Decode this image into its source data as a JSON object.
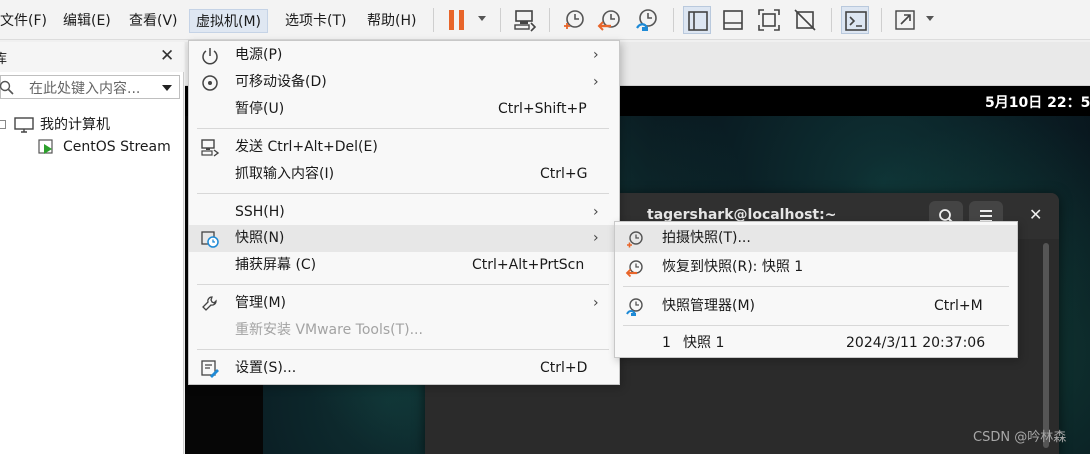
{
  "menubar": {
    "items": [
      {
        "label": "文件(F)"
      },
      {
        "label": "编辑(E)"
      },
      {
        "label": "查看(V)"
      },
      {
        "label": "虚拟机(M)"
      },
      {
        "label": "选项卡(T)"
      },
      {
        "label": "帮助(H)"
      }
    ]
  },
  "toolbar": {
    "icons": [
      "pause-icon",
      "send-ctrl-alt-del-icon",
      "snapshot-take-icon",
      "snapshot-revert-icon",
      "snapshot-manager-icon",
      "show-library-icon",
      "thumbnail-bar-icon",
      "fit-guest-icon",
      "unity-disabled-icon",
      "console-view-icon",
      "full-screen-icon"
    ],
    "accent": "#e8652a"
  },
  "library": {
    "header_fragment": "库",
    "search_placeholder": "在此处键入内容...",
    "tree": [
      {
        "label": "我的计算机"
      },
      {
        "label": "CentOS Stream"
      }
    ]
  },
  "guest": {
    "clock": "5月10日 22：5",
    "terminal_title": "tagershark@localhost:~"
  },
  "vm_menu": {
    "items": [
      {
        "label": "电源(P)",
        "shortcut": "",
        "submenu": true
      },
      {
        "label": "可移动设备(D)",
        "shortcut": "",
        "submenu": true
      },
      {
        "label": "暂停(U)",
        "shortcut": "Ctrl+Shift+P"
      },
      {
        "label": "发送 Ctrl+Alt+Del(E)",
        "shortcut": ""
      },
      {
        "label": "抓取输入内容(I)",
        "shortcut": "Ctrl+G"
      },
      {
        "label": "SSH(H)",
        "shortcut": "",
        "submenu": true
      },
      {
        "label": "快照(N)",
        "shortcut": "",
        "submenu": true
      },
      {
        "label": "捕获屏幕 (C)",
        "shortcut": "Ctrl+Alt+PrtScn"
      },
      {
        "label": "管理(M)",
        "shortcut": "",
        "submenu": true
      },
      {
        "label": "重新安装 VMware Tools(T)...",
        "shortcut": "",
        "disabled": true
      },
      {
        "label": "设置(S)...",
        "shortcut": "Ctrl+D"
      }
    ]
  },
  "snapshot_menu": {
    "take": {
      "label": "拍摄快照(T)..."
    },
    "revert": {
      "label": "恢复到快照(R): 快照 1"
    },
    "manager": {
      "label": "快照管理器(M)",
      "shortcut": "Ctrl+M"
    },
    "list": [
      {
        "index": "1",
        "name": "快照 1",
        "time": "2024/3/11 20:37:06"
      }
    ]
  },
  "watermark": "CSDN @吟林森"
}
